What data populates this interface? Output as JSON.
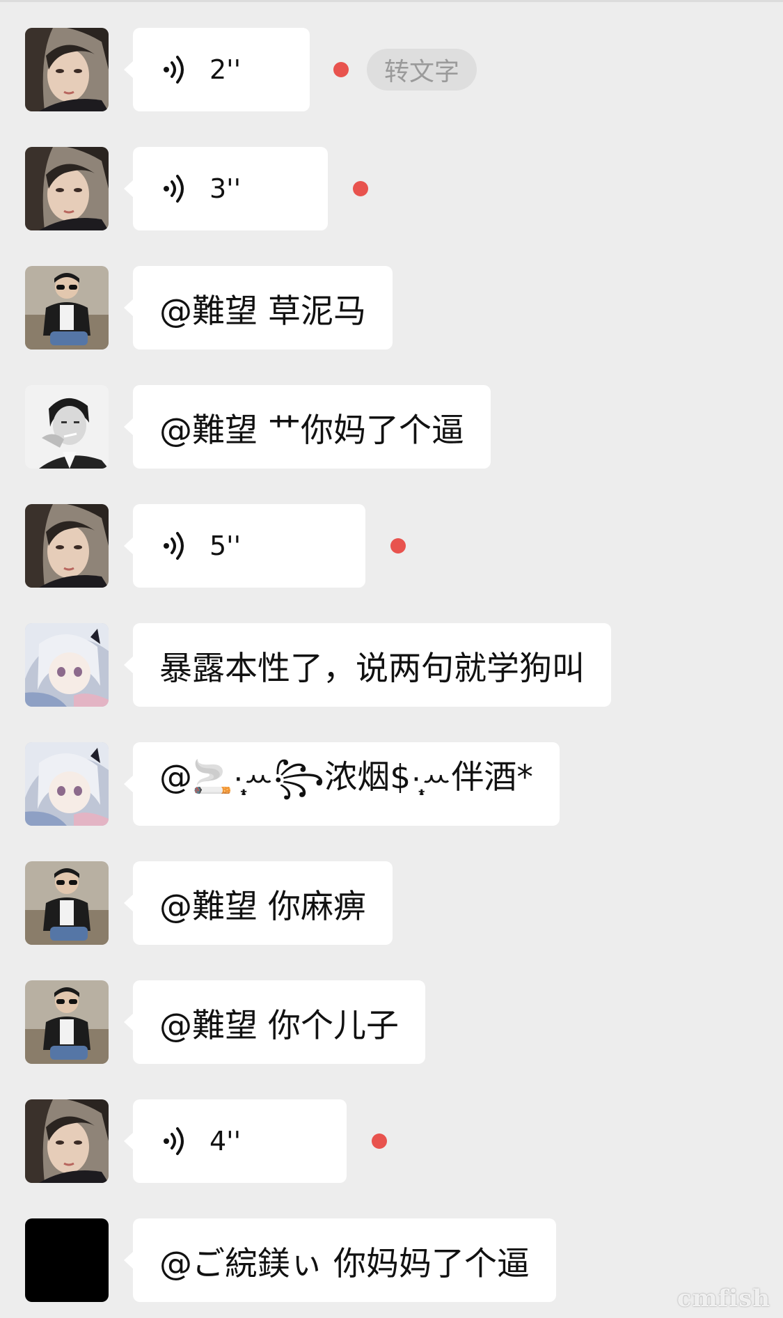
{
  "colors": {
    "background": "#ededed",
    "bubble": "#ffffff",
    "text": "#111111",
    "unread_dot": "#e8534e",
    "transcribe_bg": "#dedede",
    "transcribe_text": "#9a9a9a"
  },
  "messages": [
    {
      "type": "voice",
      "avatar": "woman-avatar",
      "duration": "2''",
      "unread": true,
      "transcribe_label": "转文字"
    },
    {
      "type": "voice",
      "avatar": "woman-avatar",
      "duration": "3''",
      "unread": true
    },
    {
      "type": "text",
      "avatar": "sunglasses-man-avatar",
      "text": "@難望 草泥马"
    },
    {
      "type": "text",
      "avatar": "smoking-man-avatar",
      "text": "@難望 艹你妈了个逼"
    },
    {
      "type": "voice",
      "avatar": "woman-avatar",
      "duration": "5''",
      "unread": true
    },
    {
      "type": "text",
      "avatar": "anime-girl-avatar",
      "text": "暴露本性了，说两句就学狗叫"
    },
    {
      "type": "text",
      "avatar": "anime-girl-avatar",
      "text": "@🚬·̩͙ꕀ꧂浓烟$·̩͙ꕀ伴酒*"
    },
    {
      "type": "text",
      "avatar": "sunglasses-man-avatar",
      "text": "@難望 你麻痹"
    },
    {
      "type": "text",
      "avatar": "sunglasses-man-avatar",
      "text": "@難望 你个儿子"
    },
    {
      "type": "voice",
      "avatar": "woman-avatar",
      "duration": "4''",
      "unread": true
    },
    {
      "type": "text",
      "avatar": "black-avatar",
      "text": "@ご綄鎂ぃ 你妈妈了个逼"
    }
  ],
  "watermark": "cmfish"
}
